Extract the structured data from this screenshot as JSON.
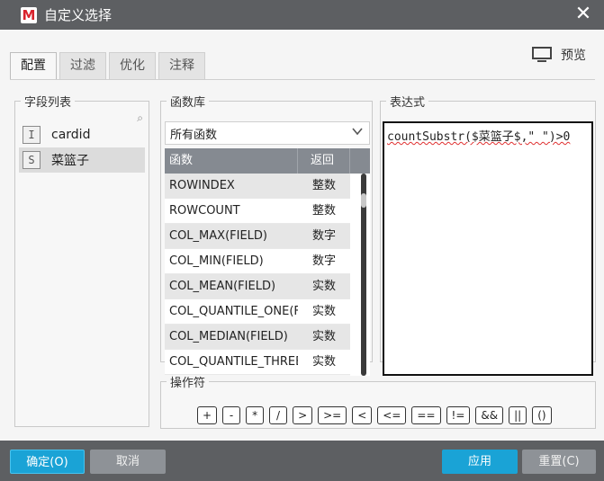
{
  "window": {
    "logo_letter": "M",
    "title": "自定义选择",
    "close_glyph": "✕"
  },
  "preview": {
    "label": "预览",
    "icon": "monitor-icon"
  },
  "tabs": [
    {
      "label": "配置",
      "active": true
    },
    {
      "label": "过滤",
      "active": false
    },
    {
      "label": "优化",
      "active": false
    },
    {
      "label": "注释",
      "active": false
    }
  ],
  "field_list": {
    "legend": "字段列表",
    "search_icon": "⌕",
    "items": [
      {
        "type_letter": "I",
        "name": "cardid",
        "selected": false
      },
      {
        "type_letter": "S",
        "name": "菜篮子",
        "selected": true
      }
    ]
  },
  "functions": {
    "legend": "函数库",
    "selected_category": "所有函数",
    "headers": {
      "name": "函数",
      "return": "返回"
    },
    "rows": [
      {
        "name": "ROWINDEX",
        "return": "整数"
      },
      {
        "name": "ROWCOUNT",
        "return": "整数"
      },
      {
        "name": "COL_MAX(FIELD)",
        "return": "数字"
      },
      {
        "name": "COL_MIN(FIELD)",
        "return": "数字"
      },
      {
        "name": "COL_MEAN(FIELD)",
        "return": "实数"
      },
      {
        "name": "COL_QUANTILE_ONE(FIELD)",
        "return": "实数"
      },
      {
        "name": "COL_MEDIAN(FIELD)",
        "return": "实数"
      },
      {
        "name": "COL_QUANTILE_THREE(FIELD)",
        "return": "实数"
      }
    ]
  },
  "expression": {
    "legend": "表达式",
    "value": "countSubstr($菜篮子$,\" \")>0"
  },
  "operators": {
    "legend": "操作符",
    "items": [
      "+",
      "-",
      "*",
      "/",
      ">",
      ">=",
      "<",
      "<=",
      "==",
      "!=",
      "&&",
      "||",
      "()"
    ]
  },
  "footer": {
    "ok": "确定(O)",
    "cancel": "取消",
    "apply": "应用",
    "reset": "重置(C)"
  }
}
